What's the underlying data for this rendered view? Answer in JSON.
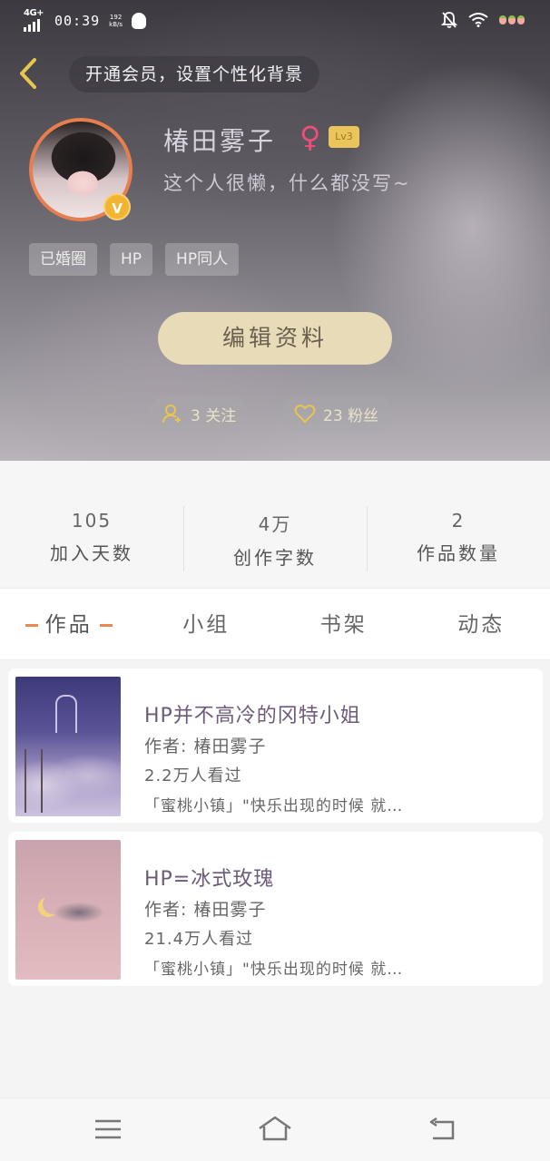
{
  "status_bar": {
    "network": "4G+",
    "time": "00:39",
    "speed_value": "192",
    "speed_unit": "kB/s"
  },
  "header": {
    "vip_prompt": "开通会员，设置个性化背景",
    "username": "椿田雾子",
    "gender_symbol": "♀",
    "level": "Lv3",
    "avatar_badge": "V",
    "bio": "这个人很懒，什么都没写~",
    "tags": [
      "已婚圈",
      "HP",
      "HP同人"
    ],
    "edit_button": "编辑资料",
    "following": "3 关注",
    "fans": "23 粉丝"
  },
  "stats": [
    {
      "value": "105",
      "label": "加入天数"
    },
    {
      "value": "4万",
      "label": "创作字数"
    },
    {
      "value": "2",
      "label": "作品数量"
    }
  ],
  "tabs": [
    {
      "label": "作品",
      "active": true
    },
    {
      "label": "小组",
      "active": false
    },
    {
      "label": "书架",
      "active": false
    },
    {
      "label": "动态",
      "active": false
    }
  ],
  "works": [
    {
      "title": "HP并不高冷的冈特小姐",
      "author": "作者: 椿田雾子",
      "views": "2.2万人看过",
      "desc": "「蜜桃小镇」\"快乐出现的时候 就…"
    },
    {
      "title": "HP=冰式玫瑰",
      "author": "作者: 椿田雾子",
      "views": "21.4万人看过",
      "desc": "「蜜桃小镇」\"快乐出现的时候 就…"
    }
  ],
  "colors": {
    "accent_orange": "#e98a55",
    "edit_button_bg": "#e7dbb8",
    "gender_pink": "#ef4e76",
    "level_gold": "#e9c55c"
  }
}
